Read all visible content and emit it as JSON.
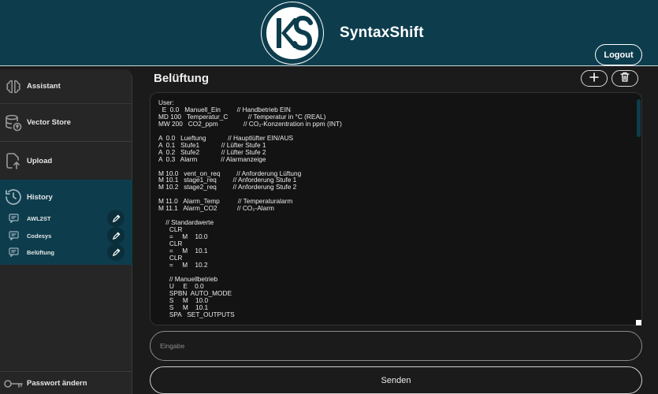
{
  "header": {
    "brand": "SyntaxShift",
    "logout_label": "Logout",
    "logo_initials": "KS"
  },
  "sidebar": {
    "items": [
      {
        "label": "Assistant",
        "icon": "brain-icon"
      },
      {
        "label": "Vector Store",
        "icon": "database-upload-icon"
      },
      {
        "label": "Upload",
        "icon": "file-upload-icon"
      }
    ],
    "history": {
      "label": "History",
      "icon": "history-icon",
      "entries": [
        {
          "label": "AWL2ST"
        },
        {
          "label": "Codesys"
        },
        {
          "label": "Belüftung"
        }
      ]
    },
    "password_label": "Passwort ändern"
  },
  "main": {
    "title": "Belüftung",
    "add_icon": "plus-icon",
    "delete_icon": "trash-icon",
    "code": "User:\n  E  0.0   Manuell_Ein         // Handbetrieb EIN\nMD 100   Temperatur_C           // Temperatur in °C (REAL)\nMW 200   CO2_ppm              // CO₂-Konzentration in ppm (INT)\n\nA  0.0   Lueftung            // Hauptlüfter EIN/AUS\nA  0.1   Stufe1            // Lüfter Stufe 1\nA  0.2   Stufe2            // Lüfter Stufe 2\nA  0.3   Alarm             // Alarmanzeige\n\nM 10.0   vent_on_req         // Anforderung Lüftung\nM 10.1   stage1_req         // Anforderung Stufe 1\nM 10.2   stage2_req         // Anforderung Stufe 2\n\nM 11.0   Alarm_Temp          // Temperaturalarm\nM 11.1   Alarm_CO2           // CO₂-Alarm\n\n    // Standardwerte\n      CLR\n      =     M    10.0\n      CLR\n      =     M    10.1\n      CLR\n      =     M    10.2\n\n      // Manuellbetrieb\n      U     E    0.0\n      SPBN  AUTO_MODE\n      S     M    10.0\n      S     M    10.1\n      SPA   SET_OUTPUTS",
    "input_placeholder": "Eingabe",
    "send_label": "Senden"
  },
  "colors": {
    "header_bg": "#0d3d4d",
    "background": "#1b1b1b",
    "sidebar_bg": "#262626",
    "history_bg": "#0d3d4d"
  }
}
